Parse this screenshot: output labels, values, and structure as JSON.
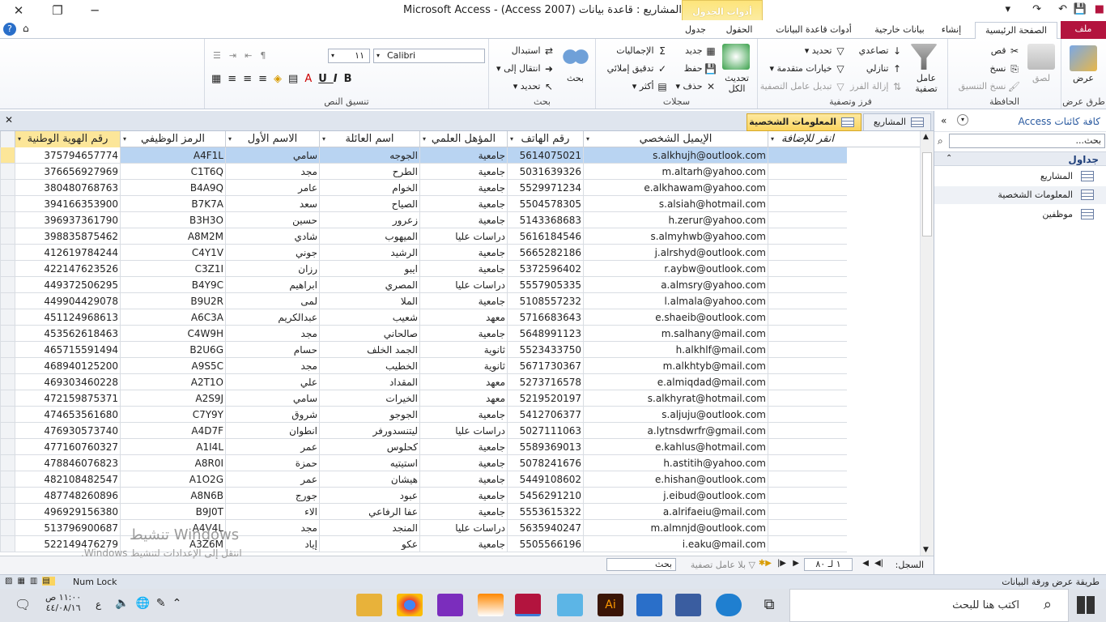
{
  "window": {
    "title": "المشاريع : قاعدة بيانات (Access 2007) - Microsoft Access",
    "context_tab_group": "أدوات الجدول"
  },
  "tabs": [
    {
      "label": "ملف"
    },
    {
      "label": "الصفحة الرئيسية"
    },
    {
      "label": "إنشاء"
    },
    {
      "label": "بيانات خارجية"
    },
    {
      "label": "أدوات قاعدة البيانات"
    },
    {
      "label": "الحقول"
    },
    {
      "label": "جدول"
    }
  ],
  "ribbon": {
    "views": {
      "label": "عرض",
      "group": "طرق عرض"
    },
    "clipboard": {
      "paste": "لصق",
      "cut": "قص",
      "copy": "نسخ",
      "format_painter": "نسخ التنسيق",
      "group": "الحافظة"
    },
    "sort_filter": {
      "filter": "عامل تصفية",
      "ascending": "تصاعدي",
      "descending": "تنازلي",
      "remove_sort": "إزالة الفرز",
      "selection": "تحديد",
      "advanced": "خيارات متقدمة",
      "toggle_filter": "تبديل عامل التصفية",
      "group": "فرز وتصفية"
    },
    "records": {
      "refresh": "تحديث الكل",
      "new": "جديد",
      "save": "حفظ",
      "delete": "حذف",
      "totals": "الإجماليات",
      "spelling": "تدقيق إملائي",
      "more": "أكثر",
      "group": "سجلات"
    },
    "find": {
      "find": "بحث",
      "replace": "استبدال",
      "goto": "انتقال إلى",
      "select": "تحديد",
      "group": "بحث"
    },
    "text_formatting": {
      "font": "Calibri",
      "size": "١١",
      "group": "تنسيق النص"
    }
  },
  "nav_pane": {
    "title": "كافة كائنات Access",
    "search_placeholder": "بحث...",
    "section": "جداول",
    "items": [
      {
        "label": "المشاريع"
      },
      {
        "label": "المعلومات الشخصية"
      },
      {
        "label": "موظفين"
      }
    ]
  },
  "doc_tabs": [
    {
      "label": "المعلومات الشخصية",
      "active": true
    },
    {
      "label": "المشاريع",
      "active": false
    }
  ],
  "table": {
    "columns": {
      "national_id": "رقم الهوية الوطنية",
      "job_code": "الرمز الوظيفي",
      "first_name": "الاسم الأول",
      "last_name": "اسم العائلة",
      "qualification": "المؤهل العلمي",
      "phone": "رقم الهاتف",
      "email": "الإيميل الشخصي",
      "add": "انقر للإضافة"
    },
    "rows": [
      [
        "375794657774",
        "A4F1L",
        "سامي",
        "الجوجه",
        "جامعية",
        "5614075021",
        "s.alkhujh@outlook.com"
      ],
      [
        "376656927969",
        "C1T6Q",
        "مجد",
        "الطرح",
        "جامعية",
        "5031639326",
        "m.altarh@yahoo.com"
      ],
      [
        "380480768763",
        "B4A9Q",
        "عامر",
        "الخوام",
        "جامعية",
        "5529971234",
        "e.alkhawam@yahoo.com"
      ],
      [
        "394166353900",
        "B7K7A",
        "سعد",
        "الصياح",
        "جامعية",
        "5504578305",
        "s.alsiah@hotmail.com"
      ],
      [
        "396937361790",
        "B3H3O",
        "حسين",
        "زعرور",
        "جامعية",
        "5143368683",
        "h.zerur@yahoo.com"
      ],
      [
        "398835875462",
        "A8M2M",
        "شادي",
        "الميهوب",
        "دراسات عليا",
        "5616184546",
        "s.almyhwb@yahoo.com"
      ],
      [
        "412619784244",
        "C4Y1V",
        "جوني",
        "الرشيد",
        "جامعية",
        "5665282186",
        "j.alrshyd@outlook.com"
      ],
      [
        "422147623526",
        "C3Z1I",
        "رزان",
        "ايبو",
        "جامعية",
        "5372596402",
        "r.aybw@outlook.com"
      ],
      [
        "449372506295",
        "B4Y9C",
        "ابراهيم",
        "المصري",
        "دراسات عليا",
        "5557905335",
        "a.almsry@yahoo.com"
      ],
      [
        "449904429078",
        "B9U2R",
        "لمى",
        "الملا",
        "جامعية",
        "5108557232",
        "l.almala@yahoo.com"
      ],
      [
        "451124968613",
        "A6C3A",
        "عبدالكريم",
        "شعيب",
        "معهد",
        "5716683643",
        "e.shaeib@outlook.com"
      ],
      [
        "453562618463",
        "C4W9H",
        "مجد",
        "صالحاني",
        "جامعية",
        "5648991123",
        "m.salhany@mail.com"
      ],
      [
        "465715591494",
        "B2U6G",
        "حسام",
        "الجمد الخلف",
        "ثانوية",
        "5523433750",
        "h.alkhlf@mail.com"
      ],
      [
        "468940125200",
        "A9S5C",
        "مجد",
        "الخطيب",
        "ثانوية",
        "5671730367",
        "m.alkhtyb@mail.com"
      ],
      [
        "469303460228",
        "A2T1O",
        "علي",
        "المقداد",
        "معهد",
        "5273716578",
        "e.almiqdad@mail.com"
      ],
      [
        "472159875371",
        "A2S9J",
        "سامي",
        "الخيرات",
        "معهد",
        "5219520197",
        "s.alkhyrat@hotmail.com"
      ],
      [
        "474653561680",
        "C7Y9Y",
        "شروق",
        "الجوجو",
        "جامعية",
        "5412706377",
        "s.aljuju@outlook.com"
      ],
      [
        "476930573740",
        "A4D7F",
        "انطوان",
        "ليتنسدورفر",
        "دراسات عليا",
        "5027111063",
        "a.lytnsdwrfr@gmail.com"
      ],
      [
        "477160760327",
        "A1I4L",
        "عمر",
        "كحلوس",
        "جامعية",
        "5589369013",
        "e.kahlus@hotmail.com"
      ],
      [
        "478846076823",
        "A8R0I",
        "حمزة",
        "استيتيه",
        "جامعية",
        "5078241676",
        "h.astitih@yahoo.com"
      ],
      [
        "482108482547",
        "A1O2G",
        "عمر",
        "هيشان",
        "جامعية",
        "5449108602",
        "e.hishan@outlook.com"
      ],
      [
        "487748260896",
        "A8N6B",
        "جورج",
        "عبود",
        "جامعية",
        "5456291210",
        "j.eibud@outlook.com"
      ],
      [
        "496929156380",
        "B9J0T",
        "الاء",
        "عفا الرفاعي",
        "جامعية",
        "5553615322",
        "a.alrifaeiu@mail.com"
      ],
      [
        "513796900687",
        "A4V4L",
        "مجد",
        "المنجد",
        "دراسات عليا",
        "5635940247",
        "m.almnjd@outlook.com"
      ],
      [
        "522149476279",
        "A3Z6M",
        "إياد",
        "عكو",
        "جامعية",
        "5505566196",
        "i.eaku@mail.com"
      ]
    ]
  },
  "record_nav": {
    "label": "السجل:",
    "position": "١ لـ ٨٠",
    "filter": "بلا عامل تصفية",
    "search": "بحث"
  },
  "status": {
    "left": "Num Lock",
    "right": "طريقة عرض ورقة البيانات"
  },
  "watermark": {
    "line1": "تنشيط Windows",
    "line2": "انتقل إلى الإعدادات لتنشيط Windows."
  },
  "taskbar": {
    "search": "اكتب هنا للبحث",
    "time": "١١:٠٠ ص",
    "date": "٤٤/٠٨/١٦",
    "lang": "ع"
  }
}
